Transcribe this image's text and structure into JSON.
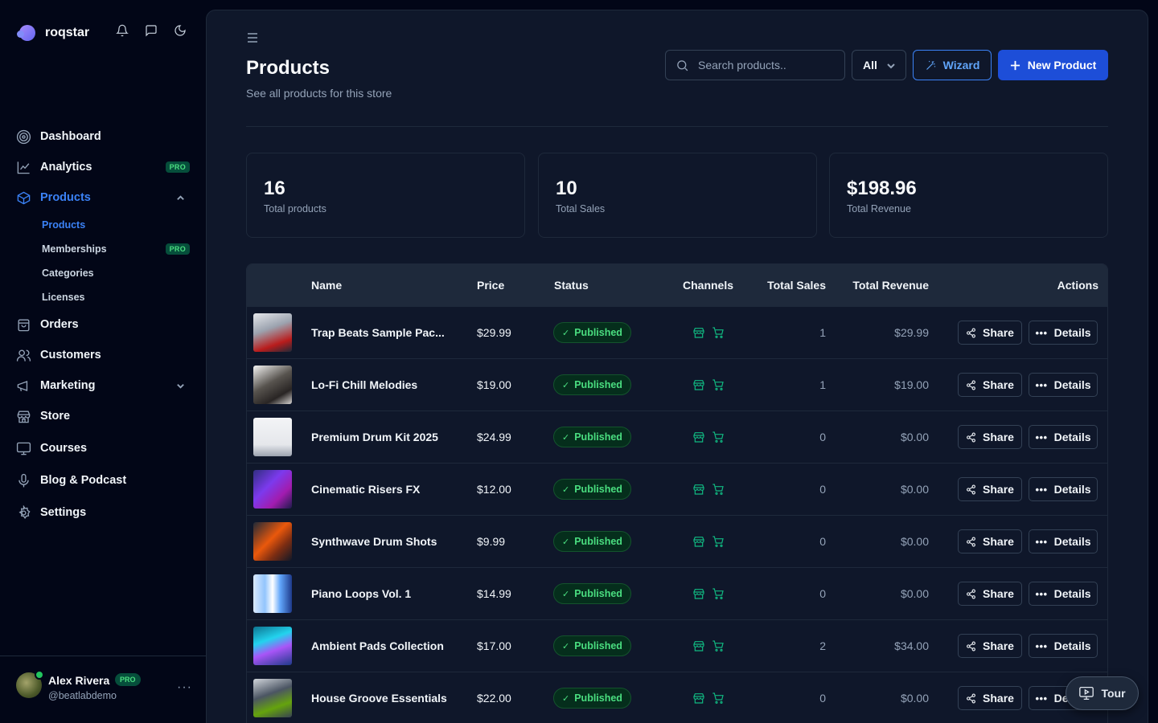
{
  "brand": {
    "name": "roqstar"
  },
  "sidebar": {
    "items": [
      {
        "label": "Dashboard",
        "icon": "dashboard-icon"
      },
      {
        "label": "Analytics",
        "icon": "chart-line-icon",
        "badge": "PRO"
      },
      {
        "label": "Products",
        "icon": "box-icon",
        "active": true
      },
      {
        "label": "Orders",
        "icon": "shopping-bag-icon"
      },
      {
        "label": "Customers",
        "icon": "users-icon"
      },
      {
        "label": "Marketing",
        "icon": "megaphone-icon"
      },
      {
        "label": "Store",
        "icon": "store-icon"
      },
      {
        "label": "Courses",
        "icon": "presentation-icon"
      },
      {
        "label": "Blog & Podcast",
        "icon": "microphone-icon"
      },
      {
        "label": "Settings",
        "icon": "gear-icon"
      }
    ],
    "products_sub": [
      {
        "label": "Products",
        "active": true
      },
      {
        "label": "Memberships",
        "badge": "PRO"
      },
      {
        "label": "Categories"
      },
      {
        "label": "Licenses"
      }
    ]
  },
  "user": {
    "name": "Alex Rivera",
    "badge": "PRO",
    "handle": "@beatlabdemo",
    "more": "···"
  },
  "header": {
    "title": "Products",
    "subtitle": "See all products for this store",
    "search_placeholder": "Search products..",
    "filter_value": "All",
    "wizard_label": "Wizard",
    "new_label": "New Product"
  },
  "stats": [
    {
      "value": "16",
      "label": "Total products"
    },
    {
      "value": "10",
      "label": "Total Sales"
    },
    {
      "value": "$198.96",
      "label": "Total Revenue"
    }
  ],
  "table": {
    "columns": [
      "Name",
      "Price",
      "Status",
      "Channels",
      "Total Sales",
      "Total Revenue",
      "Actions"
    ],
    "share_label": "Share",
    "details_label": "Details",
    "rows": [
      {
        "name": "Trap Beats Sample Pac...",
        "price": "$29.99",
        "status": "Published",
        "sales": "1",
        "revenue": "$29.99"
      },
      {
        "name": "Lo-Fi Chill Melodies",
        "price": "$19.00",
        "status": "Published",
        "sales": "1",
        "revenue": "$19.00"
      },
      {
        "name": "Premium Drum Kit 2025",
        "price": "$24.99",
        "status": "Published",
        "sales": "0",
        "revenue": "$0.00"
      },
      {
        "name": "Cinematic Risers FX",
        "price": "$12.00",
        "status": "Published",
        "sales": "0",
        "revenue": "$0.00"
      },
      {
        "name": "Synthwave Drum Shots",
        "price": "$9.99",
        "status": "Published",
        "sales": "0",
        "revenue": "$0.00"
      },
      {
        "name": "Piano Loops Vol. 1",
        "price": "$14.99",
        "status": "Published",
        "sales": "0",
        "revenue": "$0.00"
      },
      {
        "name": "Ambient Pads Collection",
        "price": "$17.00",
        "status": "Published",
        "sales": "2",
        "revenue": "$34.00"
      },
      {
        "name": "House Groove Essentials",
        "price": "$22.00",
        "status": "Published",
        "sales": "0",
        "revenue": "$0.00"
      }
    ]
  },
  "tour": {
    "label": "Tour"
  },
  "colors": {
    "accent": "#3b82f6",
    "primary_button": "#1d4ed8",
    "published": "#4ade80",
    "channel_icon": "#10b981",
    "pro_badge": "#4ade80"
  }
}
